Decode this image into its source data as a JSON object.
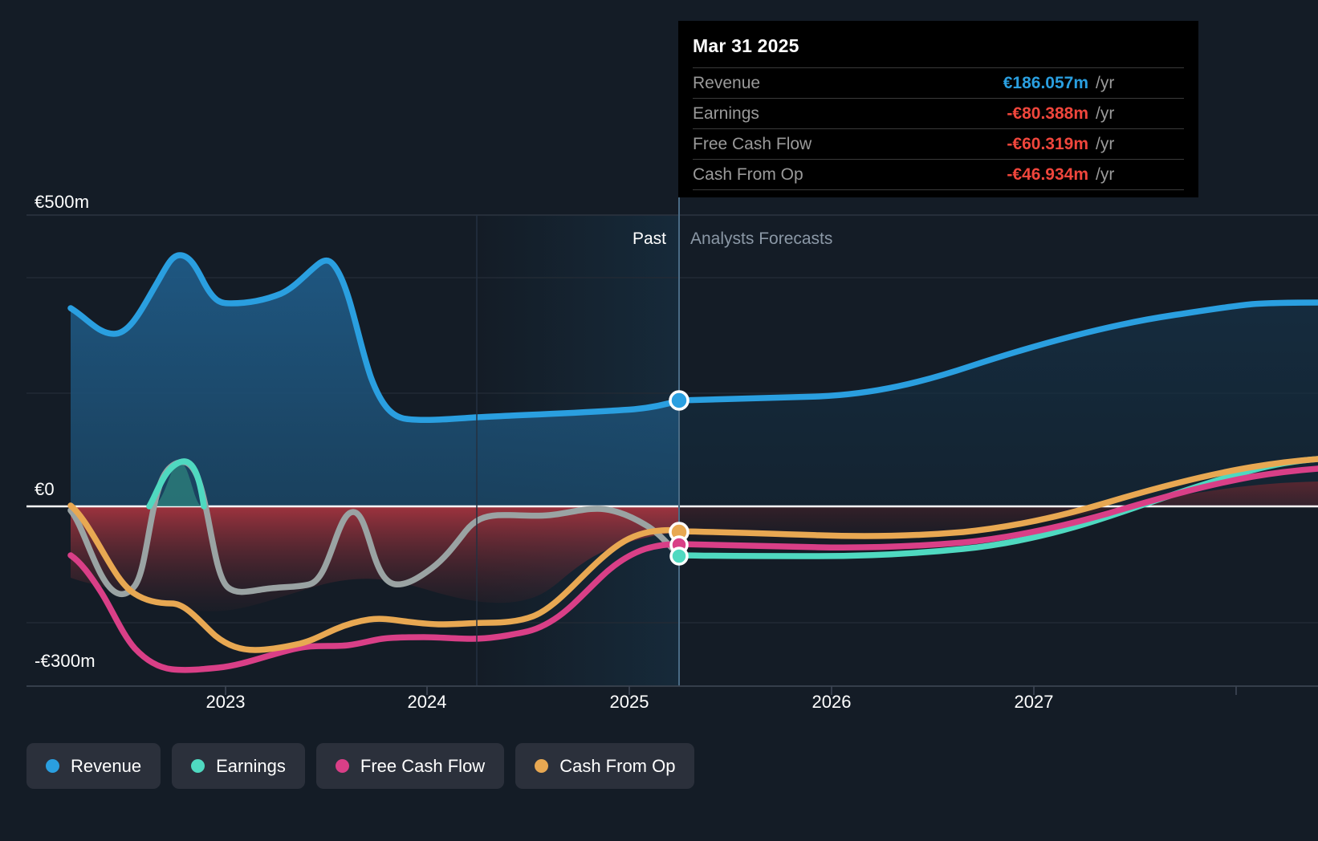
{
  "colors": {
    "revenue": "#2a9fe0",
    "earnings": "#4fd9c0",
    "free_cash_flow": "#d93f87",
    "cash_from_op": "#e8a852",
    "positive_fill": "#1d4a6b",
    "negative_fill": "#9c3340",
    "background": "#141c26",
    "forecast_band": "#101720",
    "tooltip_bg": "#000000",
    "value_positive": "#2a9fe0",
    "value_negative": "#f0463c"
  },
  "tooltip": {
    "title": "Mar 31 2025",
    "rows": [
      {
        "label": "Revenue",
        "value": "€186.057m",
        "unit": "/yr",
        "sign": "positive"
      },
      {
        "label": "Earnings",
        "value": "-€80.388m",
        "unit": "/yr",
        "sign": "negative"
      },
      {
        "label": "Free Cash Flow",
        "value": "-€60.319m",
        "unit": "/yr",
        "sign": "negative"
      },
      {
        "label": "Cash From Op",
        "value": "-€46.934m",
        "unit": "/yr",
        "sign": "negative"
      }
    ]
  },
  "zones": {
    "past_label": "Past",
    "forecast_label": "Analysts Forecasts"
  },
  "legend": [
    {
      "label": "Revenue",
      "color": "#2a9fe0"
    },
    {
      "label": "Earnings",
      "color": "#4fd9c0"
    },
    {
      "label": "Free Cash Flow",
      "color": "#d93f87"
    },
    {
      "label": "Cash From Op",
      "color": "#e8a852"
    }
  ],
  "axis": {
    "y_ticks": [
      "€500m",
      "€0",
      "-€300m"
    ],
    "x_ticks": [
      "2023",
      "2024",
      "2025",
      "2026",
      "2027"
    ]
  },
  "chart_data": {
    "type": "area",
    "title": "",
    "xlabel": "",
    "ylabel": "",
    "currency": "EUR",
    "units": "millions",
    "ylim": [
      -340,
      560
    ],
    "yticks": [
      500,
      0,
      -300
    ],
    "grid": true,
    "legend_position": "bottom-left",
    "x_tick_labels": [
      "2023",
      "2024",
      "2025",
      "2026",
      "2027"
    ],
    "x_tick_values": [
      2023.0,
      2024.0,
      2025.0,
      2026.0,
      2027.0
    ],
    "forecast_boundary": "Mar 31 2025",
    "highlight_point": {
      "date": "Mar 31 2025",
      "revenue": 186.057,
      "earnings": -80.388,
      "free_cash_flow": -60.319,
      "cash_from_op": -46.934
    },
    "series": [
      {
        "name": "Revenue",
        "color": "#2a9fe0",
        "x": [
          2022.3,
          2022.55,
          2022.75,
          2022.95,
          2023.1,
          2023.3,
          2023.52,
          2023.7,
          2023.85,
          2024.0,
          2024.3,
          2024.7,
          2025.0,
          2025.25,
          2025.6,
          2026.0,
          2026.4,
          2026.8,
          2027.2,
          2027.6,
          2027.95
        ],
        "values": [
          335,
          300,
          430,
          370,
          368,
          415,
          400,
          250,
          180,
          176,
          175,
          178,
          182,
          186.057,
          188,
          196,
          215,
          245,
          275,
          310,
          340
        ],
        "fill": true
      },
      {
        "name": "Earnings",
        "color": "#4fd9c0",
        "x": [
          2022.3,
          2022.5,
          2022.68,
          2022.8,
          2022.95,
          2023.1,
          2023.35,
          2023.6,
          2023.8,
          2024.05,
          2024.25,
          2024.5,
          2024.8,
          2025.05,
          2025.25,
          2025.6,
          2026.0,
          2026.5,
          2027.0,
          2027.4,
          2027.75,
          2027.95
        ],
        "values": [
          -5,
          -160,
          40,
          -40,
          -175,
          -175,
          -120,
          -170,
          -125,
          -50,
          -45,
          -50,
          -48,
          -70,
          -80.388,
          -92,
          -95,
          -88,
          -60,
          -25,
          10,
          32
        ],
        "fill": false
      },
      {
        "name": "Free Cash Flow",
        "color": "#d93f87",
        "x": [
          2022.3,
          2022.48,
          2022.7,
          2022.9,
          2023.05,
          2023.25,
          2023.45,
          2023.7,
          2023.95,
          2024.2,
          2024.5,
          2024.8,
          2025.05,
          2025.25,
          2025.6,
          2026.0,
          2026.5,
          2027.0,
          2027.4,
          2027.75,
          2027.95
        ],
        "values": [
          -85,
          -215,
          -275,
          -300,
          -295,
          -270,
          -245,
          -250,
          -258,
          -262,
          -245,
          -150,
          -85,
          -60.319,
          -70,
          -75,
          -68,
          -45,
          -12,
          10,
          25
        ],
        "fill": false
      },
      {
        "name": "Cash From Op",
        "color": "#e8a852",
        "x": [
          2022.3,
          2022.48,
          2022.7,
          2022.9,
          2023.05,
          2023.25,
          2023.45,
          2023.7,
          2023.95,
          2024.2,
          2024.5,
          2024.8,
          2025.05,
          2025.25,
          2025.6,
          2026.0,
          2026.5,
          2027.0,
          2027.4,
          2027.75,
          2027.95
        ],
        "values": [
          0,
          -150,
          -225,
          -265,
          -260,
          -240,
          -215,
          -225,
          -235,
          -240,
          -230,
          -130,
          -65,
          -46.934,
          -52,
          -56,
          -50,
          -30,
          0,
          22,
          38
        ],
        "fill": false
      }
    ]
  }
}
